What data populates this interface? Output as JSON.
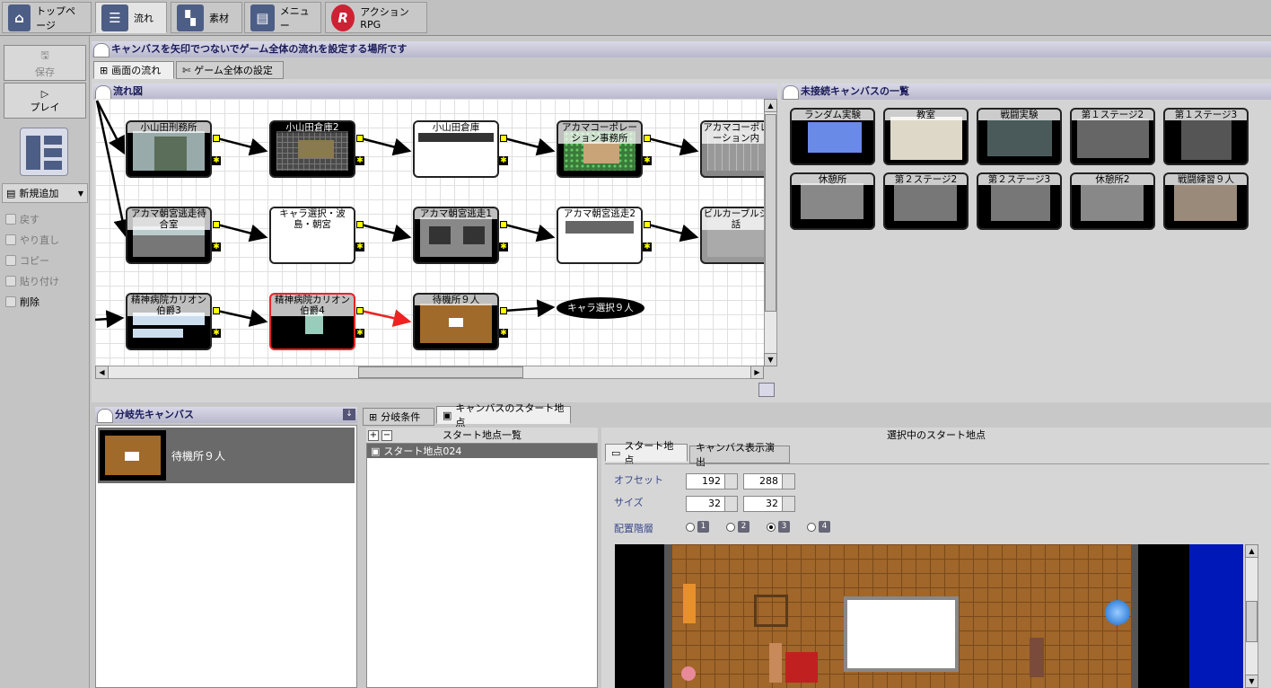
{
  "top_tabs": [
    {
      "label": "トップページ",
      "icon": "home-icon"
    },
    {
      "label": "流れ",
      "icon": "flow-icon"
    },
    {
      "label": "素材",
      "icon": "material-icon"
    },
    {
      "label": "メニュー",
      "icon": "menu-icon"
    },
    {
      "label": "アクションRPG",
      "icon": "action-rpg-icon"
    }
  ],
  "left": {
    "save": "保存",
    "play": "プレイ",
    "new_add": "新規追加",
    "undo": "戻す",
    "redo": "やり直し",
    "copy": "コピー",
    "paste": "貼り付け",
    "delete": "削除"
  },
  "header": "キャンバスを矢印でつないでゲーム全体の流れを設定する場所です",
  "sub_tabs": [
    "画面の流れ",
    "ゲーム全体の設定"
  ],
  "flow_title": "流れ図",
  "flow_nodes": [
    "小山田刑務所",
    "小山田倉庫2",
    "小山田倉庫",
    "アカマコーポレーション事務所",
    "アカマコーポレーション内",
    "アカマ朝宮逃走待合室",
    "キャラ選択・波島・朝宮",
    "アカマ朝宮逃走1",
    "アカマ朝宮逃走2",
    "ビルカーブルジ話",
    "精神病院カリオン伯爵3",
    "精神病院カリオン伯爵4",
    "待機所９人"
  ],
  "flow_oval": "キャラ選択９人",
  "unconnected_title": "未接続キャンバスの一覧",
  "unconnected": [
    "ランダム実験",
    "教室",
    "戦闘実験",
    "第１ステージ2",
    "第１ステージ3",
    "休憩所",
    "第２ステージ2",
    "第２ステージ3",
    "休憩所2",
    "戦闘練習９人"
  ],
  "branch_title": "分岐先キャンバス",
  "branch_item": "待機所９人",
  "bottom_tabs": [
    "分岐条件",
    "キャンバスのスタート地点"
  ],
  "start_list_title": "スタート地点一覧",
  "start_item": "スタート地点024",
  "selected_title": "選択中のスタート地点",
  "right_tabs": [
    "スタート地点",
    "キャンバス表示演出"
  ],
  "offset_label": "オフセット",
  "offset_x": "192",
  "offset_y": "288",
  "size_label": "サイズ",
  "size_w": "32",
  "size_h": "32",
  "layer_label": "配置階層",
  "layers": [
    "1",
    "2",
    "3",
    "4"
  ],
  "layer_selected": "3"
}
